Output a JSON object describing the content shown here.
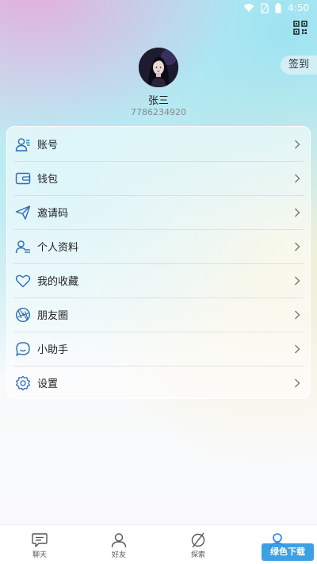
{
  "status_bar": {
    "time": "4:50"
  },
  "header": {
    "signin_label": "签到"
  },
  "profile": {
    "name": "张三",
    "id": "7786234920"
  },
  "menu": {
    "items": [
      {
        "label": "账号",
        "icon": "account-icon"
      },
      {
        "label": "钱包",
        "icon": "wallet-icon"
      },
      {
        "label": "邀请码",
        "icon": "send-icon"
      },
      {
        "label": "个人资料",
        "icon": "profile-info-icon"
      },
      {
        "label": "我的收藏",
        "icon": "heart-icon"
      },
      {
        "label": "朋友圈",
        "icon": "aperture-icon"
      },
      {
        "label": "小助手",
        "icon": "chat-bubble-icon"
      },
      {
        "label": "设置",
        "icon": "gear-icon"
      }
    ]
  },
  "tabs": [
    {
      "label": "聊天",
      "icon": "chat-icon"
    },
    {
      "label": "好友",
      "icon": "friends-icon"
    },
    {
      "label": "探索",
      "icon": "explore-icon"
    },
    {
      "label": "",
      "icon": "me-icon",
      "active": true
    }
  ],
  "watermark": {
    "text": "绿色下载"
  },
  "colors": {
    "accent": "#2b7de9",
    "icon_stroke": "#2b6cb0"
  }
}
